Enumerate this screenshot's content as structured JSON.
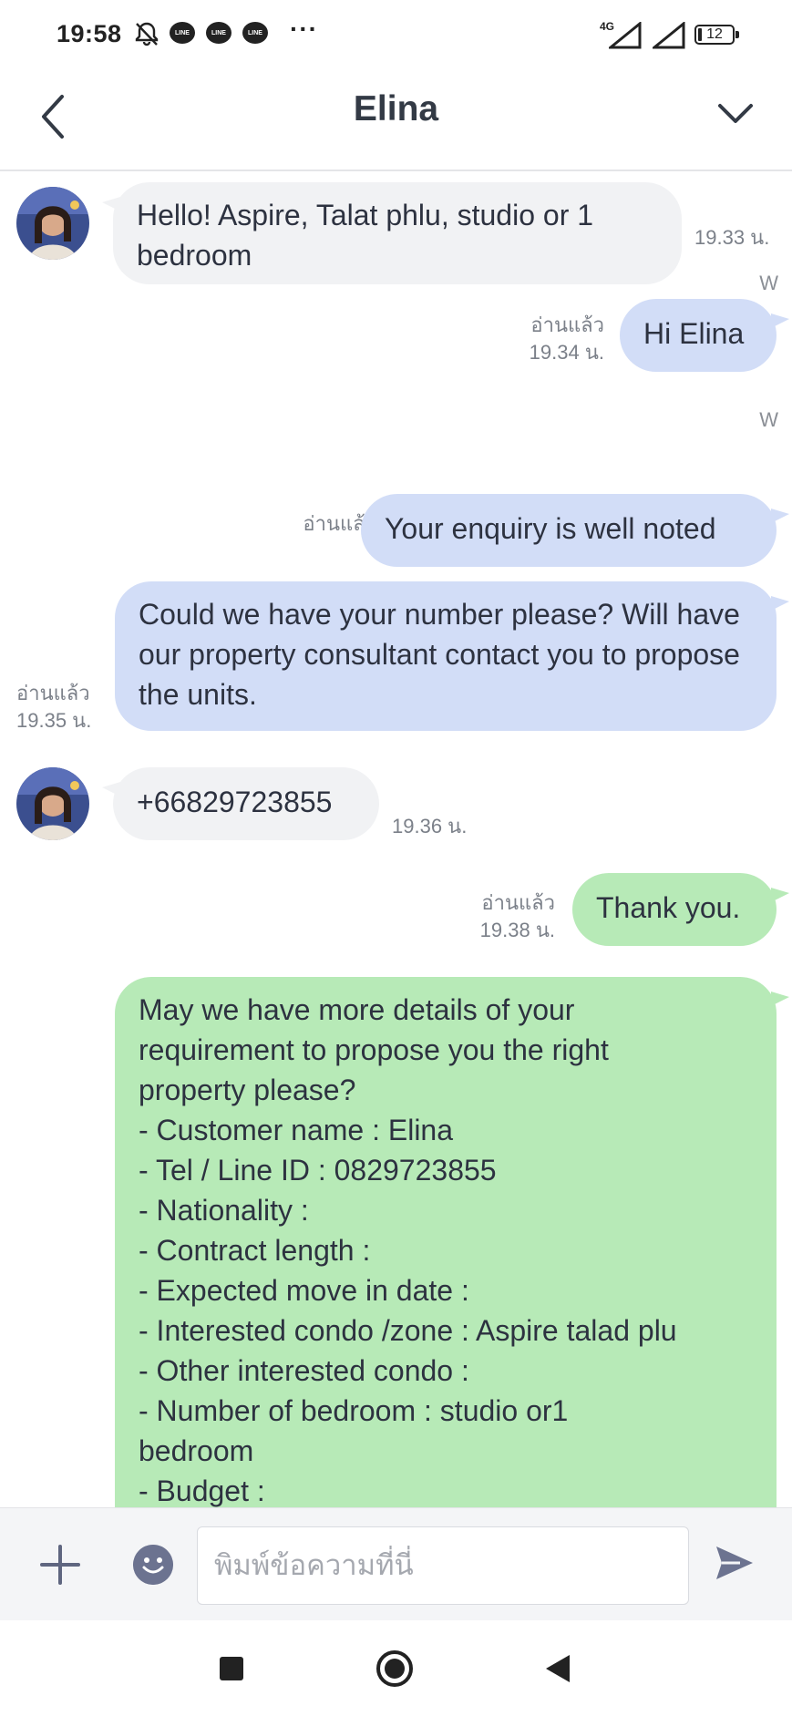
{
  "status_bar": {
    "time": "19:58",
    "network": "4G",
    "battery": "12",
    "notification_icons": [
      "bell-off-icon",
      "line-icon",
      "line-icon",
      "line-icon"
    ],
    "line_badge_text": "LINE",
    "more": "···"
  },
  "header": {
    "title": "Elina",
    "back_icon": "chevron-left-icon",
    "menu_icon": "chevron-down-icon"
  },
  "messages": [
    {
      "from": "contact",
      "text": "Hello! Aspire, Talat phlu, studio or 1 bedroom",
      "time": "19.33 น."
    },
    {
      "from": "me",
      "sender": "W",
      "read": "อ่านแล้ว",
      "time": "19.34 น.",
      "text": "Hi Elina"
    },
    {
      "from": "me",
      "sender": "W",
      "read": "อ่านแล้ว",
      "time": "",
      "text": "Your enquiry is well noted"
    },
    {
      "from": "me",
      "sender": "",
      "read": "อ่านแล้ว",
      "time": "19.35 น.",
      "text": "Could we have your number please? Will have our property consultant contact you to propose the units."
    },
    {
      "from": "contact",
      "text": "+66829723855",
      "time": "19.36 น."
    },
    {
      "from": "me",
      "sender": "",
      "read": "อ่านแล้ว",
      "time": "19.38 น.",
      "text": "Thank you."
    },
    {
      "from": "me",
      "sender": "",
      "read": "",
      "time": "",
      "lines": [
        "May we have more details of your",
        "requirement to propose you the right",
        "property please?",
        "- Customer name : Elina",
        "- Tel / Line ID : 0829723855",
        "- Nationality :",
        "- Contract length :",
        "- Expected move in date :",
        "- Interested condo /zone : Aspire talad plu",
        "- Other interested condo :",
        "- Number of bedroom  : studio or1",
        "bedroom",
        "- Budget :"
      ]
    }
  ],
  "input": {
    "placeholder": "พิมพ์ข้อความที่นี่",
    "add_icon": "plus-icon",
    "emoji_icon": "emoji-icon",
    "send_icon": "send-icon"
  },
  "colors": {
    "incoming_bubble": "#f1f2f4",
    "outgoing_blue": "#d2ddf7",
    "outgoing_green": "#b7eab7"
  }
}
